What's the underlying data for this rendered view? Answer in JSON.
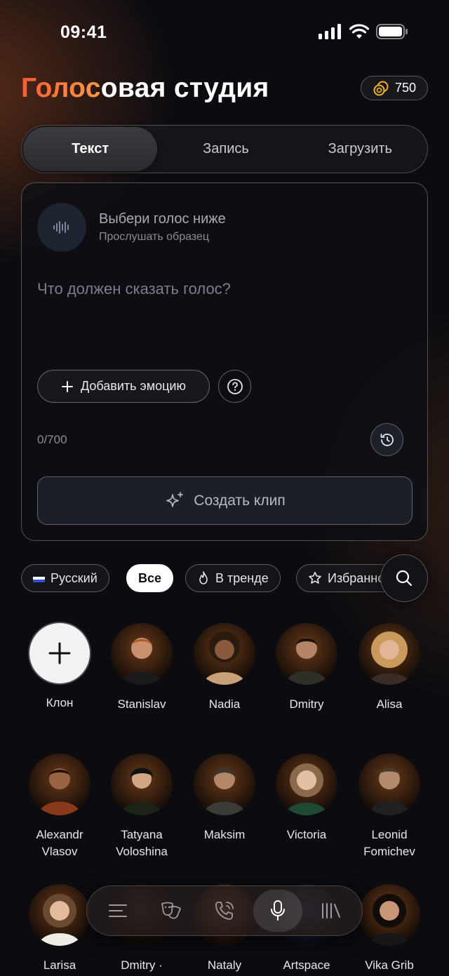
{
  "status_bar": {
    "time": "09:41"
  },
  "header": {
    "title_accent": "Голос",
    "title_rest": "овая студия",
    "coins": "750"
  },
  "tabs": [
    {
      "label": "Текст",
      "active": true
    },
    {
      "label": "Запись",
      "active": false
    },
    {
      "label": "Загрузить",
      "active": false
    }
  ],
  "composer": {
    "voice_title": "Выбери голос ниже",
    "voice_subtitle": "Прослушать образец",
    "placeholder": "Что должен сказать голос?",
    "emotion_label": "Добавить эмоцию",
    "counter": "0/700",
    "create_label": "Создать клип"
  },
  "filters": {
    "language": "Русский",
    "all": "Все",
    "trending": "В тренде",
    "favorites": "Избранное"
  },
  "voices": [
    {
      "name": "Клон"
    },
    {
      "name": "Stanislav"
    },
    {
      "name": "Nadia"
    },
    {
      "name": "Dmitry"
    },
    {
      "name": "Alisa"
    },
    {
      "name": "Alexandr Vlasov"
    },
    {
      "name": "Tatyana Voloshina"
    },
    {
      "name": "Maksim"
    },
    {
      "name": "Victoria"
    },
    {
      "name": "Leonid Fomichev"
    },
    {
      "name": "Larisa"
    },
    {
      "name": "Dmitry ·"
    },
    {
      "name": "Nataly"
    },
    {
      "name": "Artspace"
    },
    {
      "name": "Vika Grib"
    }
  ],
  "nav": [
    {
      "icon": "menu-icon",
      "active": false
    },
    {
      "icon": "theater-masks-icon",
      "active": false
    },
    {
      "icon": "phone-call-icon",
      "active": false
    },
    {
      "icon": "microphone-icon",
      "active": true
    },
    {
      "icon": "library-icon",
      "active": false
    }
  ],
  "colors": {
    "accent_start": "#ff5a36",
    "accent_end": "#ff9a45",
    "background": "#0b0b10"
  }
}
